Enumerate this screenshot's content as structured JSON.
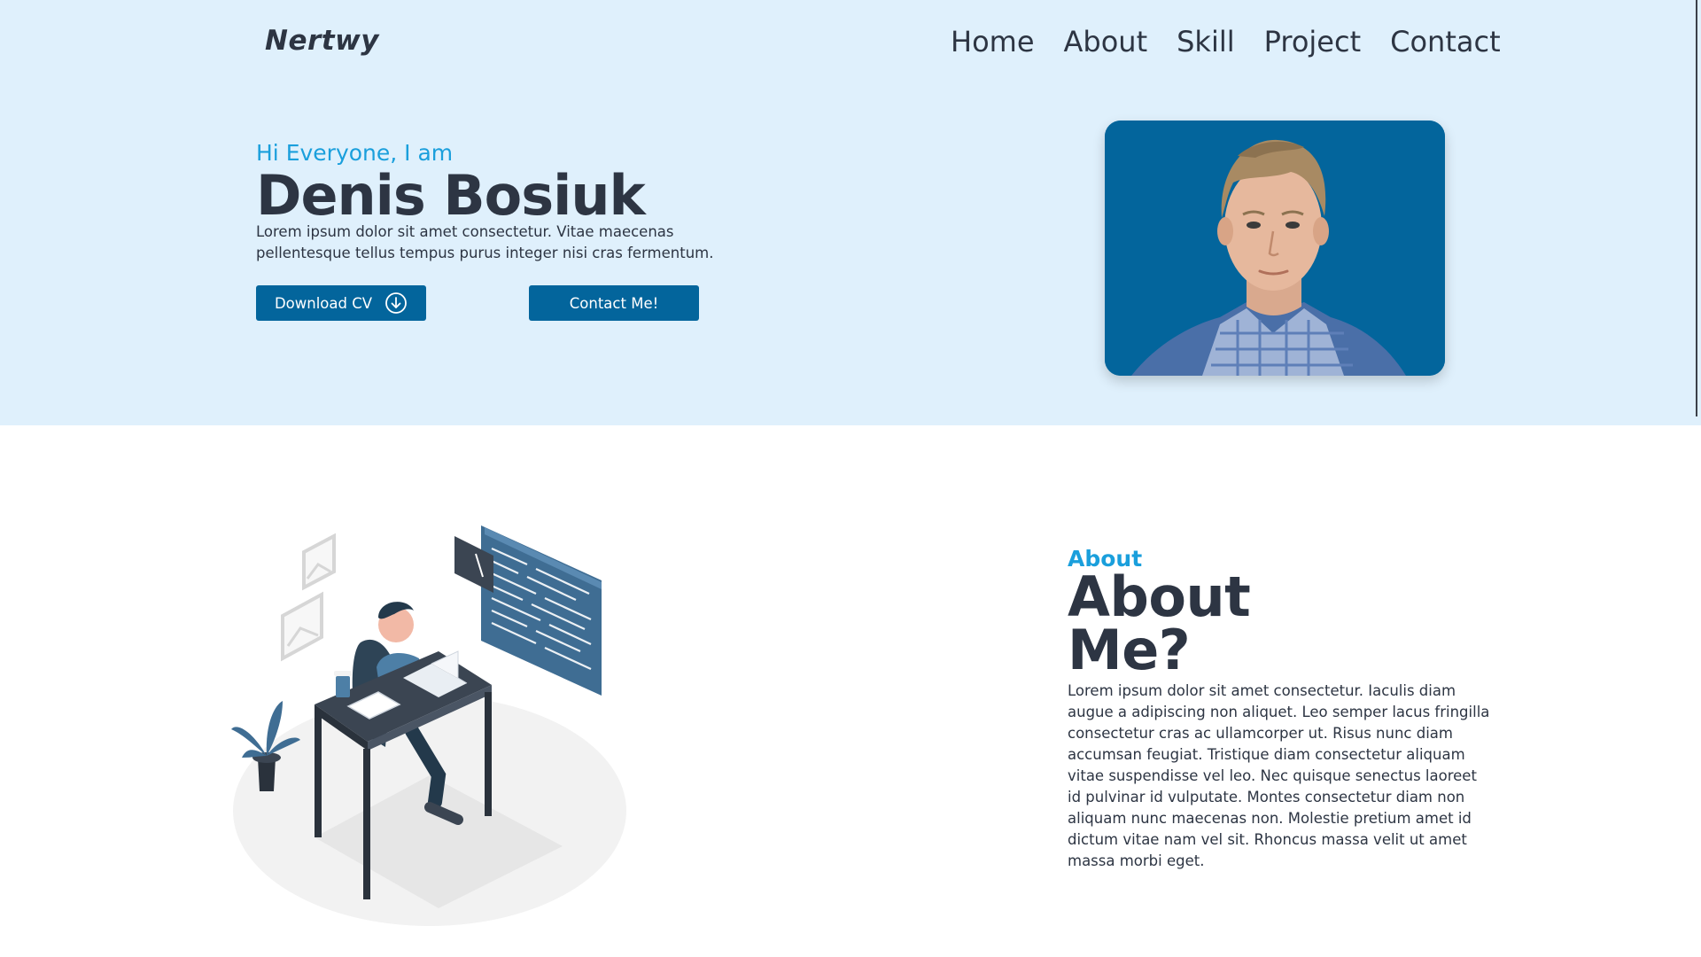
{
  "brand": {
    "logo": "Nertwy"
  },
  "nav": {
    "items": [
      "Home",
      "About",
      "Skill",
      "Project",
      "Contact"
    ]
  },
  "hero": {
    "greeting": "Hi Everyone, I am",
    "name": "Denis Bosiuk",
    "description": "Lorem ipsum dolor sit amet consectetur. Vitae maecenas pellentesque tellus tempus purus integer nisi cras fermentum.",
    "download_label": "Download CV",
    "download_icon": "download-circle-icon",
    "contact_label": "Contact Me!"
  },
  "about": {
    "kicker": "About",
    "title": "About Me?",
    "text": "Lorem ipsum dolor sit amet consectetur. Iaculis diam augue a adipiscing non aliquet. Leo semper lacus fringilla consectetur cras ac ullamcorper ut. Risus nunc diam accumsan feugiat. Tristique diam consectetur aliquam vitae suspendisse vel leo. Nec quisque senectus laoreet id pulvinar id vulputate. Montes consectetur diam non aliquam nunc maecenas non. Molestie pretium amet id dictum vitae nam vel sit. Rhoncus massa velit ut amet massa morbi eget."
  },
  "colors": {
    "hero_bg": "#dff0fc",
    "primary": "#03659c",
    "accent": "#1a9fdc",
    "text": "#2d3543"
  }
}
